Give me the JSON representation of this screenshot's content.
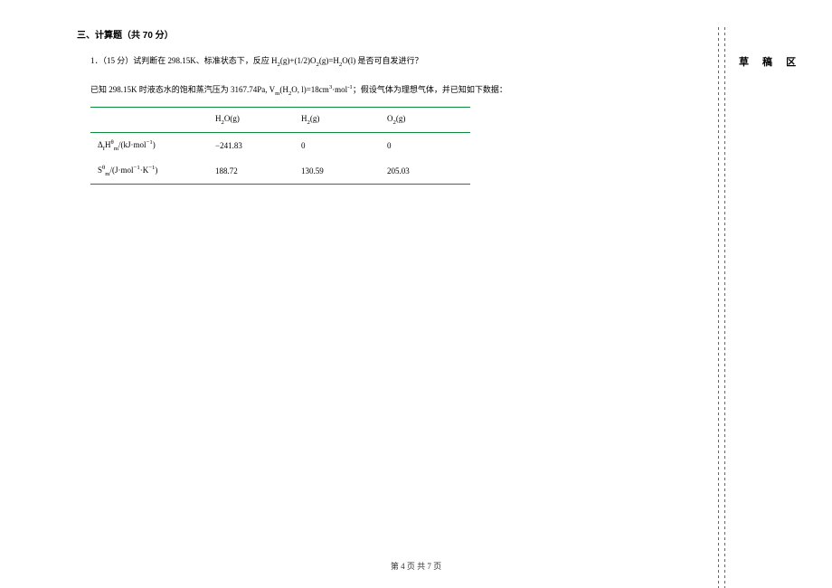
{
  "section": {
    "title": "三、计算题（共 70 分）"
  },
  "question": {
    "line1_prefix": "1．（15 分）试判断在 298.15K、标准状态下，反应 H",
    "line1_sub1": "2",
    "line1_mid1": "(g)+(1/2)O",
    "line1_sub2": "2",
    "line1_mid2": "(g)=H",
    "line1_sub3": "2",
    "line1_suffix": "O(l) 是否可自发进行？",
    "line2_prefix": "已知 298.15K 时液态水的饱和蒸汽压为 3167.74Pa, V",
    "line2_sub_m": "m",
    "line2_mid1": "(H",
    "line2_sub4": "2",
    "line2_mid2": "O, l)=18cm",
    "line2_sup3": "3",
    "line2_mid3": "·mol",
    "line2_supneg1": "-1",
    "line2_suffix": "；假设气体为理想气体，并已知如下数据："
  },
  "table": {
    "header": {
      "col1": "",
      "col2_pre": "H",
      "col2_sub": "2",
      "col2_suf": "O(g)",
      "col3_pre": "H",
      "col3_sub": "2",
      "col3_suf": "(g)",
      "col4_pre": "O",
      "col4_sub": "2",
      "col4_suf": "(g)"
    },
    "row1": {
      "label_pre": "Δ",
      "label_sub1": "f",
      "label_mid": "H",
      "label_sup": "θ",
      "label_sub2": "m",
      "label_unit_pre": "/(kJ·mol",
      "label_unit_sup": "−1",
      "label_unit_suf": ")",
      "v1": "−241.83",
      "v2": "0",
      "v3": "0"
    },
    "row2": {
      "label_pre": "S",
      "label_sup": "θ",
      "label_sub": "m",
      "label_unit_pre": "/(J·mol",
      "label_unit_sup1": "−1",
      "label_unit_mid": "·K",
      "label_unit_sup2": "−1",
      "label_unit_suf": ")",
      "v1": "188.72",
      "v2": "130.59",
      "v3": "205.03"
    }
  },
  "sidebar": {
    "draft_title": "草 稿 区"
  },
  "footer": {
    "text": "第 4 页 共 7 页"
  },
  "chart_data": {
    "type": "table",
    "title": "Thermodynamic data at 298.15K",
    "columns": [
      "",
      "H2O(g)",
      "H2(g)",
      "O2(g)"
    ],
    "rows": [
      {
        "label": "ΔfHθm/(kJ·mol−1)",
        "values": [
          -241.83,
          0,
          0
        ]
      },
      {
        "label": "Sθm/(J·mol−1·K−1)",
        "values": [
          188.72,
          130.59,
          205.03
        ]
      }
    ]
  }
}
